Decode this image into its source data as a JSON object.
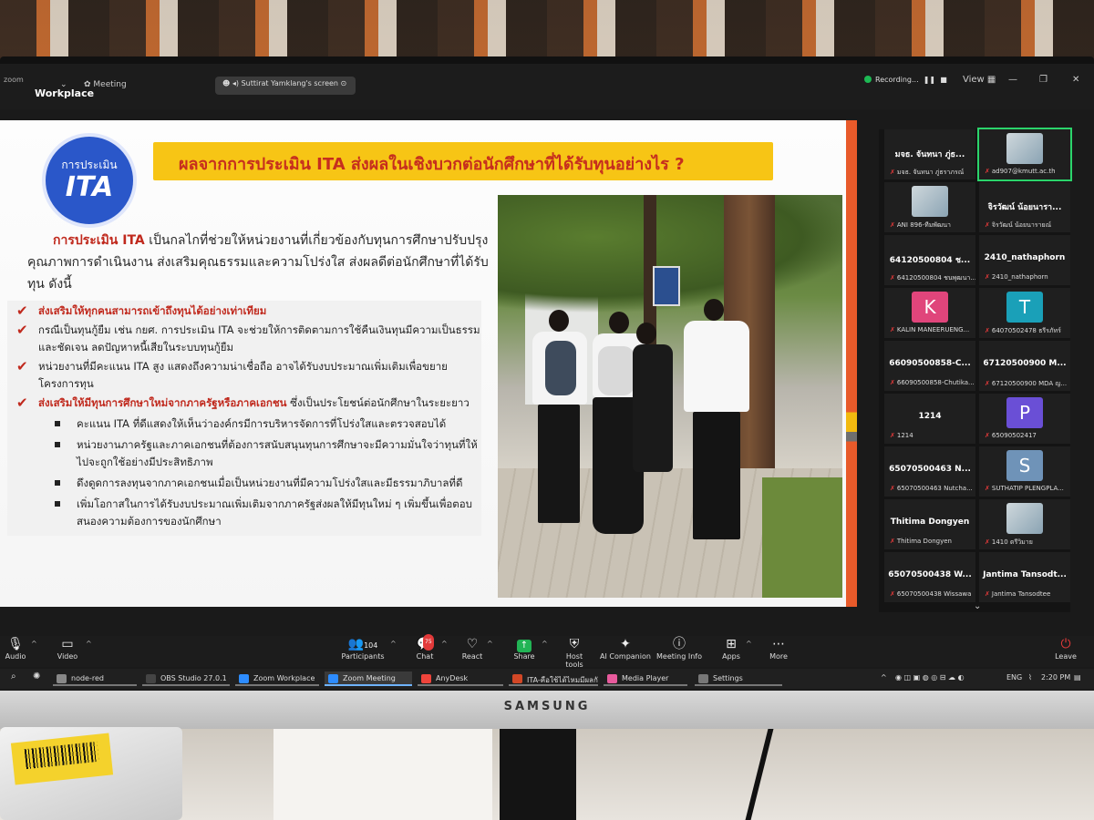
{
  "monitor_brand": "SAMSUNG",
  "zoom": {
    "app_logo_small": "zoom",
    "app_logo": "Workplace",
    "meeting_label": "Meeting",
    "share_pill": "Suttirat Yamklang's screen",
    "recording_label": "Recording...",
    "view_label": "View"
  },
  "slide": {
    "badge_top": "การประเมิน",
    "badge_main": "ITA",
    "title": "ผลจากการประเมิน ITA ส่งผลในเชิงบวกต่อนักศึกษาที่ได้รับทุนอย่างไร ?",
    "intro_lead": "การประเมิน ITA",
    "intro_rest": " เป็นกลไกที่ช่วยให้หน่วยงานที่เกี่ยวข้องกับทุนการศึกษาปรับปรุงคุณภาพการดำเนินงาน ส่งเสริมคุณธรรมและความโปร่งใส ส่งผลดีต่อนักศึกษาที่ได้รับทุน ดังนี้",
    "bullets": [
      {
        "red": "ส่งเสริมให้ทุกคนสามารถเข้าถึงทุนได้อย่างเท่าเทียม",
        "text": ""
      },
      {
        "red": "",
        "text": "กรณีเป็นทุนกู้ยืม เช่น กยศ. การประเมิน ITA จะช่วยให้การติดตามการใช้คืนเงินทุนมีความเป็นธรรมและชัดเจน ลดปัญหาหนี้เสียในระบบทุนกู้ยืม"
      },
      {
        "red": "",
        "text": "หน่วยงานที่มีคะแนน ITA สูง แสดงถึงความน่าเชื่อถือ อาจได้รับงบประมาณเพิ่มเติมเพื่อขยายโครงการทุน"
      },
      {
        "red": "ส่งเสริมให้มีทุนการศึกษาใหม่จากภาครัฐหรือภาคเอกชน",
        "text": " ซึ่งเป็นประโยชน์ต่อนักศึกษาในระยะยาว"
      }
    ],
    "sub_bullets": [
      "คะแนน ITA ที่ดีแสดงให้เห็นว่าองค์กรมีการบริหารจัดการที่โปร่งใสและตรวจสอบได้",
      "หน่วยงานภาครัฐและภาคเอกชนที่ต้องการสนับสนุนทุนการศึกษาจะมีความมั่นใจว่าทุนที่ให้ไปจะถูกใช้อย่างมีประสิทธิภาพ",
      "ดึงดูดการลงทุนจากภาคเอกชนเมื่อเป็นหน่วยงานที่มีความโปร่งใสและมีธรรมาภิบาลที่ดี",
      "เพิ่มโอกาสในการได้รับงบประมาณเพิ่มเติมจากภาครัฐส่งผลให้มีทุนใหม่ ๆ เพิ่มขึ้นเพื่อตอบสนองความต้องการของนักศึกษา"
    ]
  },
  "participants": [
    {
      "name": "มจธ. จันทนา ภู่ธ...",
      "label": "มจธ. จันทนา ภู่ธราภรณ์",
      "avatar": "",
      "color": ""
    },
    {
      "name": "",
      "label": "ad907@kmutt.ac.th",
      "avatar": "",
      "color": ""
    },
    {
      "name": "",
      "label": "ANI 896-ทีมพัฒนา",
      "avatar": "",
      "color": ""
    },
    {
      "name": "จิรวัฒน์ น้อยนารา...",
      "label": "จิรวัฒน์ น้อยนารายณ์",
      "avatar": "",
      "color": ""
    },
    {
      "name": "64120500804 ช...",
      "label": "64120500804 ชนพุฒนา...",
      "avatar": "",
      "color": ""
    },
    {
      "name": "2410_nathaphorn",
      "label": "2410_nathaphorn",
      "avatar": "",
      "color": ""
    },
    {
      "name": "",
      "label": "KALIN MANEERUENG...",
      "avatar": "K",
      "color": "#e0457b"
    },
    {
      "name": "",
      "label": "64070502478 ธรีรภัทร์",
      "avatar": "T",
      "color": "#1aa0b8"
    },
    {
      "name": "66090500858-C...",
      "label": "66090500858-Chutika...",
      "avatar": "",
      "color": ""
    },
    {
      "name": "67120500900 M...",
      "label": "67120500900 MDA ญ...",
      "avatar": "",
      "color": ""
    },
    {
      "name": "1214",
      "label": "1214",
      "avatar": "",
      "color": ""
    },
    {
      "name": "",
      "label": "65090502417",
      "avatar": "P",
      "color": "#6a4fd6"
    },
    {
      "name": "65070500463 N...",
      "label": "65070500463 Nutcha...",
      "avatar": "",
      "color": ""
    },
    {
      "name": "",
      "label": "SUTHATIP PLENGPLA...",
      "avatar": "S",
      "color": "#6f93b8"
    },
    {
      "name": "Thitima Dongyen",
      "label": "Thitima Dongyen",
      "avatar": "",
      "color": ""
    },
    {
      "name": "",
      "label": "1410 ตรีวิมาย",
      "avatar": "",
      "color": ""
    },
    {
      "name": "65070500438 W...",
      "label": "65070500438 Wissawa",
      "avatar": "",
      "color": ""
    },
    {
      "name": "Jantima Tansodt...",
      "label": "Jantima Tansodtee",
      "avatar": "",
      "color": ""
    }
  ],
  "controls": {
    "audio": "Audio",
    "video": "Video",
    "participants": "Participants",
    "participants_count": "104",
    "chat": "Chat",
    "chat_badge": "75",
    "react": "React",
    "share": "Share",
    "host_tools": "Host tools",
    "ai_companion": "AI Companion",
    "meeting_info": "Meeting Info",
    "apps": "Apps",
    "more": "More",
    "leave": "Leave"
  },
  "taskbar": {
    "items": [
      {
        "label": "node-red",
        "color": "#888"
      },
      {
        "label": "OBS Studio 27.0.1 (64...",
        "color": "#444"
      },
      {
        "label": "Zoom Workplace",
        "color": "#2d8cff"
      },
      {
        "label": "Zoom Meeting",
        "color": "#2d8cff"
      },
      {
        "label": "AnyDesk",
        "color": "#ef443b"
      },
      {
        "label": "ITA-คือใช้ได้ไหมมีผลกับทุนหม...",
        "color": "#d24726"
      },
      {
        "label": "Media Player",
        "color": "#e85a9c"
      },
      {
        "label": "Settings",
        "color": "#777"
      }
    ],
    "lang": "ENG",
    "time": "2:20 PM"
  }
}
